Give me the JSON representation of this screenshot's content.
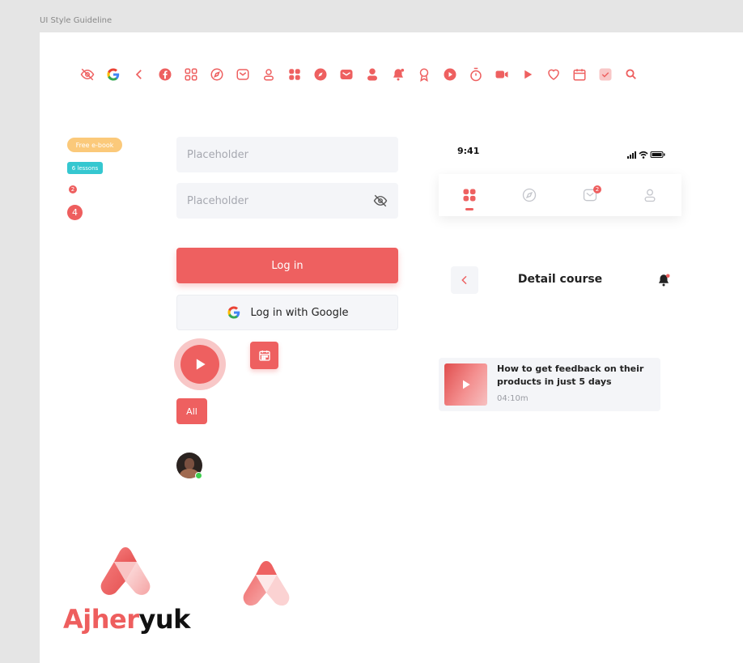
{
  "frame_label": "UI Style Guideline",
  "colors": {
    "primary": "#ee6060",
    "primary_light": "#f8c7c7",
    "badge_yellow": "#fbc97a",
    "badge_teal": "#35c7d0",
    "field_bg": "#f4f5f8",
    "online_green": "#3fcf4f",
    "brand_dark": "#111111"
  },
  "icons": [
    "eye-off-icon",
    "google-icon",
    "chevron-left-icon",
    "facebook-icon",
    "grid-outline-icon",
    "compass-outline-icon",
    "mail-outline-icon",
    "user-outline-icon",
    "grid-filled-icon",
    "compass-filled-icon",
    "mail-filled-icon",
    "user-filled-icon",
    "bell-filled-icon",
    "award-icon",
    "play-circle-icon",
    "stopwatch-icon",
    "video-icon",
    "play-icon",
    "heart-icon",
    "calendar-icon",
    "checkbox-icon",
    "search-icon"
  ],
  "badges": {
    "ebook": "Free e-book",
    "lessons": "6 lessons",
    "small_count": "2",
    "large_count": "4"
  },
  "form": {
    "field1_placeholder": "Placeholder",
    "field2_placeholder": "Placeholder",
    "login_label": "Log in",
    "google_label": "Log in with Google"
  },
  "chip_all": "All",
  "phone": {
    "time": "9:41",
    "tab_badge": "2"
  },
  "detail": {
    "title": "Detail course"
  },
  "course": {
    "title": "How to get feedback on their products in just 5 days",
    "duration": "04:10m"
  },
  "brand": {
    "part1": "Ajher",
    "part2": "yuk"
  }
}
